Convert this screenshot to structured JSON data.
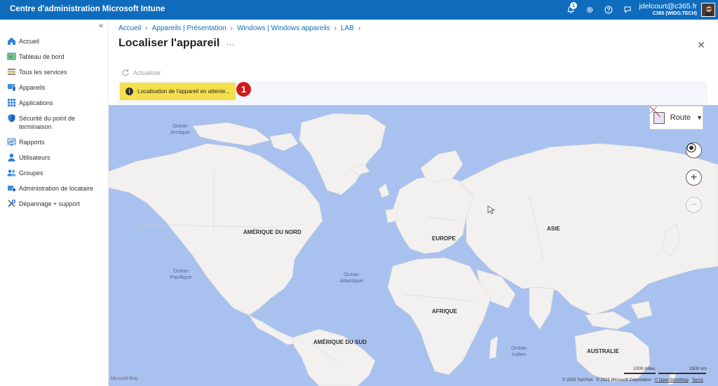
{
  "app": {
    "title": "Centre d'administration Microsoft Intune"
  },
  "header": {
    "notification_count": "1",
    "icons": [
      "bell-icon",
      "gear-icon",
      "help-icon",
      "feedback-icon"
    ],
    "user_name": "jdelcourt@c365.fr",
    "tenant": "C365 (WIDO.TECH)"
  },
  "sidebar": {
    "collapse_glyph": "«",
    "items": [
      {
        "label": "Accueil",
        "icon": "home-icon"
      },
      {
        "label": "Tableau de bord",
        "icon": "dashboard-icon"
      },
      {
        "label": "Tous les services",
        "icon": "all-services-icon"
      },
      {
        "label": "Appareils",
        "icon": "devices-icon"
      },
      {
        "label": "Applications",
        "icon": "apps-icon"
      },
      {
        "label": "Sécurité du point de terminaison",
        "icon": "endpoint-security-icon"
      },
      {
        "label": "Rapports",
        "icon": "reports-icon"
      },
      {
        "label": "Utilisateurs",
        "icon": "users-icon"
      },
      {
        "label": "Groupes",
        "icon": "groups-icon"
      },
      {
        "label": "Administration de locataire",
        "icon": "tenant-admin-icon"
      },
      {
        "label": "Dépannage + support",
        "icon": "troubleshoot-icon"
      }
    ]
  },
  "breadcrumb": [
    "Accueil",
    "Appareils | Présentation",
    "Windows | Windows appareils",
    "LAB"
  ],
  "page": {
    "title": "Localiser l'appareil",
    "more": "···",
    "close": "✕",
    "refresh_label": "Actualiser",
    "status_message": "Localisation de l'appareil en attente...",
    "callout_number": "1"
  },
  "map": {
    "style_label": "Route",
    "continents": [
      "AMÉRIQUE DU NORD",
      "EUROPE",
      "ASIE",
      "AFRIQUE",
      "AMÉRIQUE DU SUD",
      "AUSTRALIE"
    ],
    "oceans": [
      "Océan Arctique",
      "Océan Pacifique",
      "Océan Atlantique",
      "Océan Indien"
    ],
    "scale_miles": "1000 miles",
    "scale_km": "2500 km",
    "attribution_1": "© 2025 TomTom",
    "attribution_2": "© 2025 Microsoft Corporation",
    "attribution_3": "© OpenStreetMap",
    "attribution_4": "Terms",
    "provider_logo": "Microsoft Bing",
    "colors": {
      "water": "#a9c1ef",
      "land": "#f2f1ef",
      "status": "#f4e04d",
      "callout": "#d11a1a",
      "brand": "#0f6cbd"
    }
  }
}
